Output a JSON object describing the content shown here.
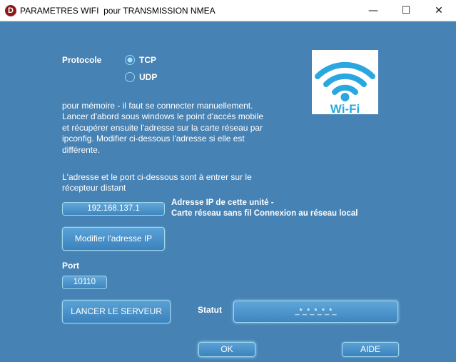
{
  "window": {
    "app_icon_letter": "D",
    "title": "PARAMETRES WIFI  pour TRANSMISSION NMEA",
    "controls": {
      "minimize": "—",
      "maximize": "☐",
      "close": "✕"
    }
  },
  "protocol": {
    "label": "Protocole",
    "options": [
      {
        "label": "TCP",
        "checked": true
      },
      {
        "label": "UDP",
        "checked": false
      }
    ]
  },
  "memo_lines": [
    "pour mémoire - il faut se connecter manuellement.",
    "Lancer d'abord sous windows le point d'accés mobile",
    "et récupérer ensuite l'adresse sur la carte réseau par",
    "ipconfig.  Modifier ci-dessous l'adresse si elle est",
    "différente."
  ],
  "remote_lines": [
    "L'adresse et le port ci-dessous sont à entrer sur le",
    "récepteur distant"
  ],
  "ip": {
    "value": "192.168.137.1",
    "desc_lines": [
      "Adresse IP de cette unité -",
      "Carte réseau sans fil Connexion au réseau local"
    ],
    "modify_button": "Modifier l'adresse IP"
  },
  "port": {
    "label": "Port",
    "value": "10110"
  },
  "server_button": "LANCER LE SERVEUR",
  "status": {
    "label": "Statut",
    "value": "_*_*_*_*_*_"
  },
  "footer": {
    "ok_button": "OK",
    "help_button": "AIDE"
  },
  "wifi_logo": {
    "text": "Wi-Fi",
    "color": "#2aa7e0"
  },
  "colors": {
    "background": "#4682b4",
    "radio_accent": "#9fe6ff"
  }
}
